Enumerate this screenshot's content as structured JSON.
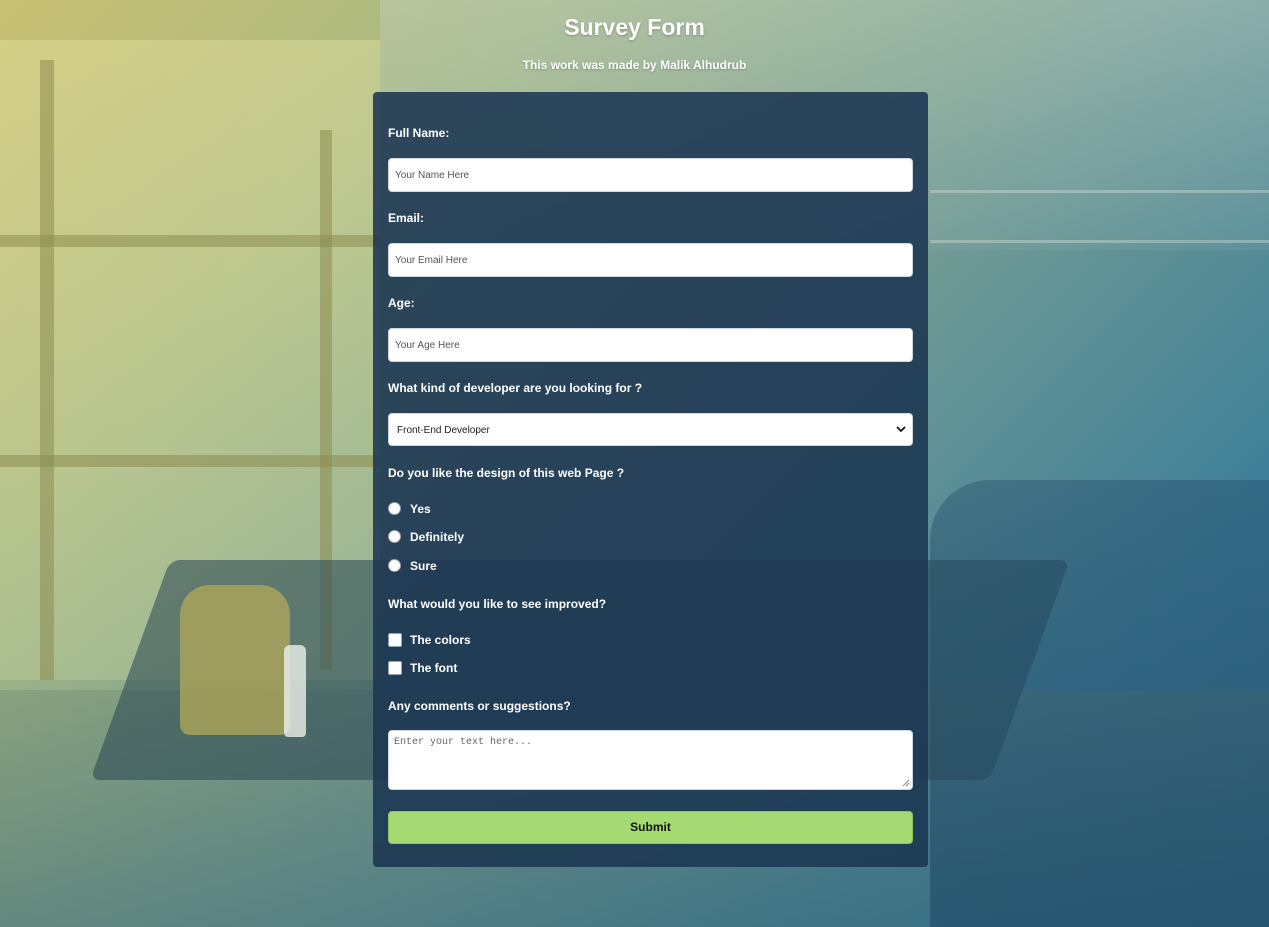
{
  "header": {
    "title": "Survey Form",
    "subtitle": "This work was made by Malik Alhudrub"
  },
  "form": {
    "name": {
      "label": "Full Name:",
      "placeholder": "Your Name Here"
    },
    "email": {
      "label": "Email:",
      "placeholder": "Your Email Here"
    },
    "age": {
      "label": "Age:",
      "placeholder": "Your Age Here"
    },
    "developer": {
      "label": "What kind of developer are you looking for ?",
      "selected": "Front-End Developer"
    },
    "design": {
      "label": "Do you like the design of this web Page ?",
      "options": [
        "Yes",
        "Definitely",
        "Sure"
      ]
    },
    "improve": {
      "label": "What would you like to see improved?",
      "options": [
        "The colors",
        "The font"
      ]
    },
    "comments": {
      "label": "Any comments or suggestions?",
      "placeholder": "Enter your text here..."
    },
    "submit_label": "Submit"
  },
  "colors": {
    "panel": "#1b3552",
    "submit": "#a5da72",
    "text": "#ffffff"
  }
}
